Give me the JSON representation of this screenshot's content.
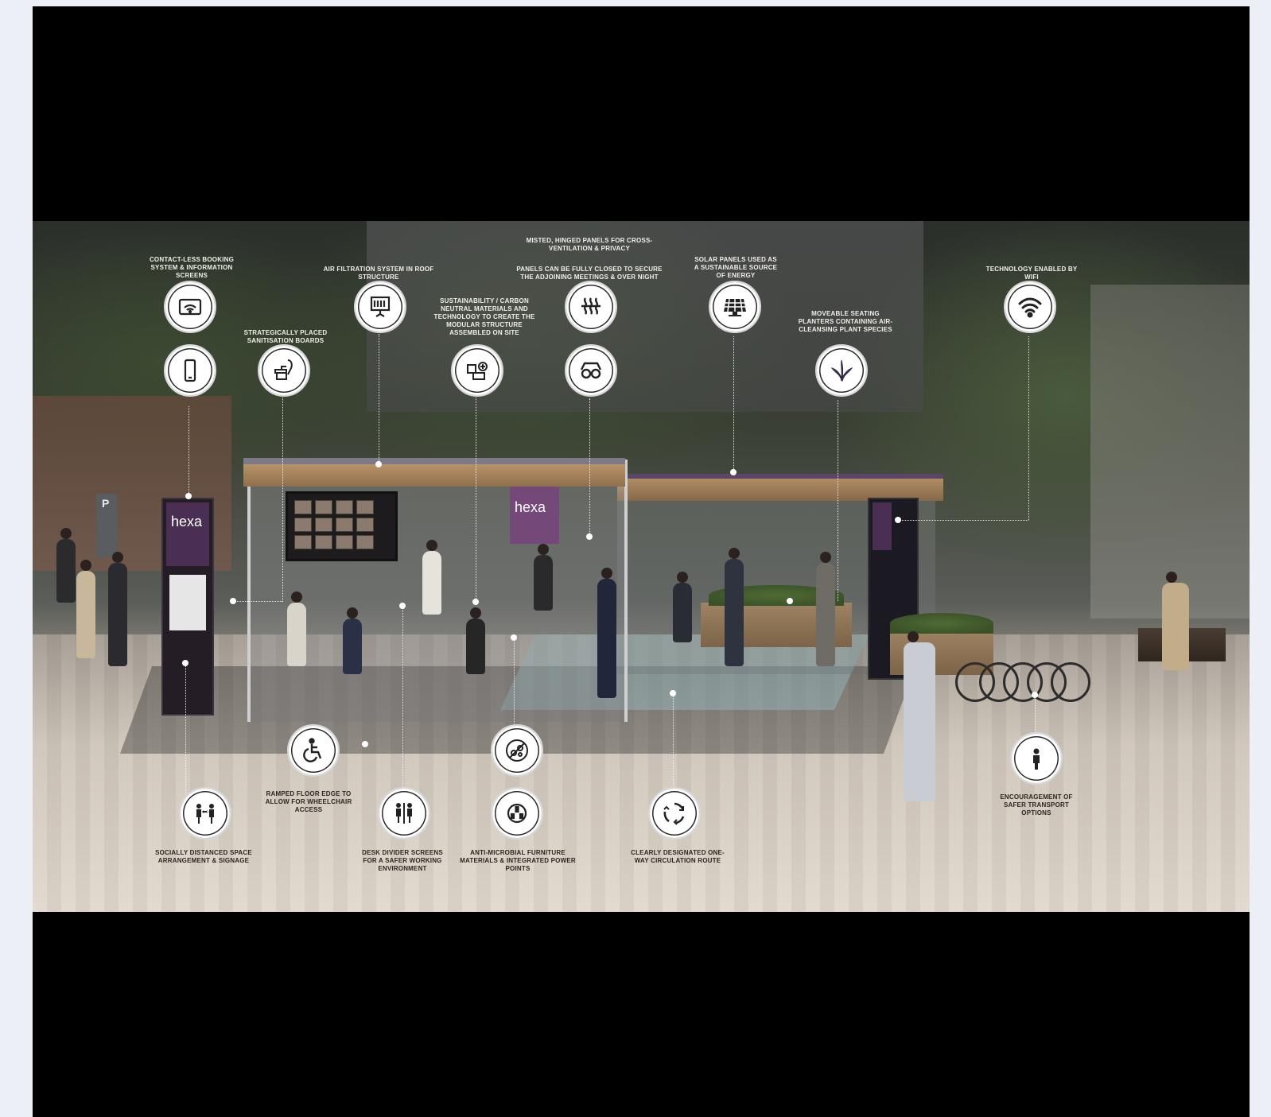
{
  "image": {
    "description_colors": {
      "letterbox": "#000000",
      "page_background": "#eceff6",
      "icon_fill": "#ffffff",
      "icon_stroke": "#2a2a2a",
      "brand_purple": "#74497a"
    }
  },
  "signage": {
    "brand_left": "hexa",
    "brand_banner": "hexa",
    "parking_sign": "P"
  },
  "callouts": [
    {
      "id": "booking-screen",
      "icon": "screen-wifi-icon",
      "label": "CONTACT-LESS BOOKING SYSTEM & INFORMATION SCREENS"
    },
    {
      "id": "air-filtration",
      "icon": "air-filter-icon",
      "label": "AIR FILTRATION SYSTEM IN ROOF STRUCTURE"
    },
    {
      "id": "hinged-panels",
      "icon": "ventilation-icon",
      "label": "MISTED, HINGED PANELS FOR CROSS-VENTILATION & PRIVACY"
    },
    {
      "id": "panels-closed",
      "icon": "glasses-icon",
      "label": "PANELS CAN BE FULLY CLOSED TO SECURE THE ADJOINING MEETINGS & OVER NIGHT"
    },
    {
      "id": "solar-panels",
      "icon": "solar-panel-icon",
      "label": "SOLAR PANELS USED AS A SUSTAINABLE SOURCE OF ENERGY"
    },
    {
      "id": "technology-wifi",
      "icon": "wifi-icon",
      "label": "TECHNOLOGY ENABLED BY WIFI"
    },
    {
      "id": "mobile-phone",
      "icon": "smartphone-icon",
      "label": ""
    },
    {
      "id": "sanitisation",
      "icon": "sanitiser-icon",
      "label": "STRATEGICALLY PLACED SANITISATION BOARDS"
    },
    {
      "id": "sustainability",
      "icon": "modular-structure-icon",
      "label": "SUSTAINABILITY / CARBON NEUTRAL MATERIALS AND TECHNOLOGY TO CREATE THE MODULAR STRUCTURE ASSEMBLED ON SITE"
    },
    {
      "id": "seating-planting",
      "icon": "plant-icon",
      "label": "MOVEABLE SEATING PLANTERS CONTAINING AIR-CLEANSING PLANT SPECIES"
    },
    {
      "id": "wheelchair",
      "icon": "wheelchair-icon",
      "label": "RAMPED FLOOR EDGE TO ALLOW FOR WHEELCHAIR ACCESS"
    },
    {
      "id": "anti-microbial-top",
      "icon": "no-bacteria-icon",
      "label": ""
    },
    {
      "id": "social-distance",
      "icon": "social-distance-icon",
      "label": "SOCIALLY DISTANCED SPACE ARRANGEMENT & SIGNAGE"
    },
    {
      "id": "desk-screens",
      "icon": "people-divider-icon",
      "label": "DESK DIVIDER SCREENS FOR A SAFER WORKING ENVIRONMENT"
    },
    {
      "id": "anti-microbial",
      "icon": "power-socket-icon",
      "label": "ANTI-MICROBIAL FURNITURE MATERIALS & INTEGRATED POWER POINTS"
    },
    {
      "id": "circulation",
      "icon": "circular-arrows-icon",
      "label": "CLEARLY DESIGNATED ONE-WAY CIRCULATION ROUTE"
    },
    {
      "id": "safer-transport",
      "icon": "person-icon",
      "label": "ENCOURAGEMENT OF SAFER TRANSPORT OPTIONS"
    }
  ]
}
